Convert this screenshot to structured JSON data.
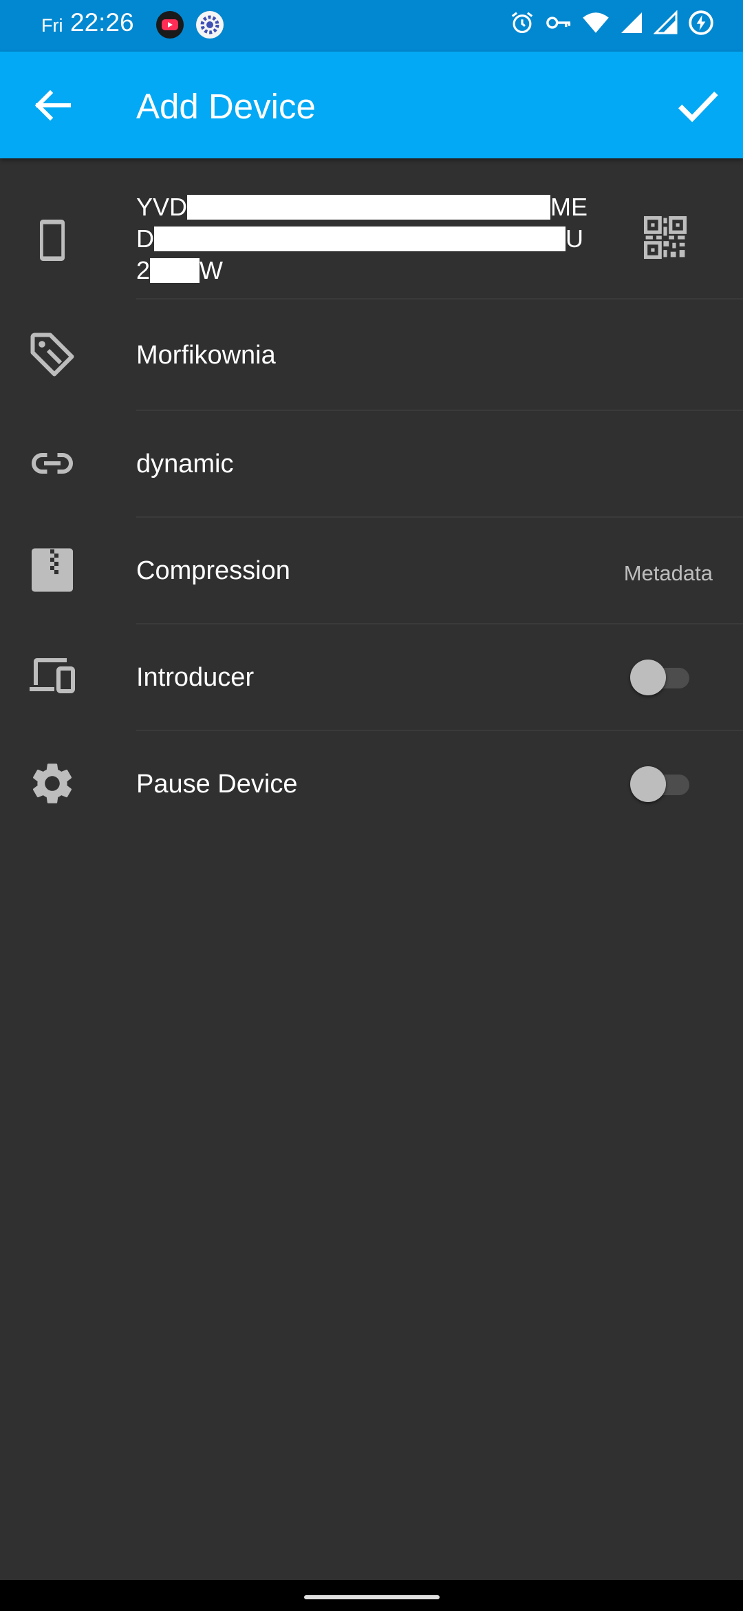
{
  "status_bar": {
    "day": "Fri",
    "time": "22:26",
    "left_icons": [
      "youtube-notification-icon",
      "settings-notification-icon"
    ],
    "right_icons": [
      "alarm-icon",
      "vpn-key-icon",
      "wifi-icon",
      "signal-icon",
      "signal-icon-2",
      "battery-charging-icon"
    ]
  },
  "app_bar": {
    "title": "Add Device",
    "back_icon": "arrow-back-icon",
    "confirm_icon": "check-icon"
  },
  "device_id": {
    "line1_start": "YVD",
    "line1_end": "ME",
    "line2_start": "D",
    "line2_end": "U",
    "line3_start": "2",
    "line3_end": "W",
    "qr_icon": "qr-code-icon"
  },
  "rows": {
    "name": "Morfikownia",
    "address": "dynamic",
    "compression_label": "Compression",
    "compression_value": "Metadata",
    "introducer_label": "Introducer",
    "introducer_on": false,
    "pause_label": "Pause Device",
    "pause_on": false
  },
  "colors": {
    "app_bar": "#03a9f4",
    "status_bar": "#0288d1",
    "background": "#303030"
  }
}
